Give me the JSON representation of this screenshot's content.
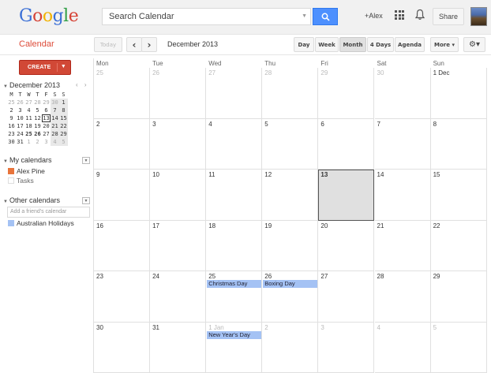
{
  "header": {
    "logo_letters": [
      "G",
      "o",
      "o",
      "g",
      "l",
      "e"
    ],
    "logo_colors": [
      "#3a6fd6",
      "#d64336",
      "#f2b200",
      "#3a6fd6",
      "#2f9e44",
      "#d64336"
    ],
    "search_placeholder": "Search Calendar",
    "user_label": "+Alex",
    "share_label": "Share"
  },
  "toolbar": {
    "app_name": "Calendar",
    "today_label": "Today",
    "prev_glyph": "‹",
    "next_glyph": "›",
    "period": "December 2013",
    "views": [
      "Day",
      "Week",
      "Month",
      "4 Days",
      "Agenda"
    ],
    "active_view": "Month",
    "more_label": "More ▾",
    "settings_glyph": "⚙▾"
  },
  "sidebar": {
    "create_label": "CREATE",
    "mini_title": "December 2013",
    "mini_nav": "‹ ›",
    "mini_dow": [
      "M",
      "T",
      "W",
      "T",
      "F",
      "S",
      "S"
    ],
    "mini_weeks": [
      [
        "25",
        "26",
        "27",
        "28",
        "29",
        "30",
        "1"
      ],
      [
        "2",
        "3",
        "4",
        "5",
        "6",
        "7",
        "8"
      ],
      [
        "9",
        "10",
        "11",
        "12",
        "13",
        "14",
        "15"
      ],
      [
        "16",
        "17",
        "18",
        "19",
        "20",
        "21",
        "22"
      ],
      [
        "23",
        "24",
        "25",
        "26",
        "27",
        "28",
        "29"
      ],
      [
        "30",
        "31",
        "1",
        "2",
        "3",
        "4",
        "5"
      ]
    ],
    "my_calendars_label": "My calendars",
    "my_calendars": [
      {
        "name": "Alex Pine",
        "color": "#e8743b"
      },
      {
        "name": "Tasks",
        "color": "#ffffff"
      }
    ],
    "other_calendars_label": "Other calendars",
    "add_friend_placeholder": "Add a friend's calendar",
    "other_calendars": [
      {
        "name": "Australian Holidays",
        "color": "#a4c2f4"
      }
    ]
  },
  "calendar": {
    "dow": [
      "Mon",
      "Tue",
      "Wed",
      "Thu",
      "Fri",
      "Sat",
      "Sun"
    ],
    "weeks": [
      [
        "25",
        "26",
        "27",
        "28",
        "29",
        "30",
        "1 Dec"
      ],
      [
        "2",
        "3",
        "4",
        "5",
        "6",
        "7",
        "8"
      ],
      [
        "9",
        "10",
        "11",
        "12",
        "13",
        "14",
        "15"
      ],
      [
        "16",
        "17",
        "18",
        "19",
        "20",
        "21",
        "22"
      ],
      [
        "23",
        "24",
        "25",
        "26",
        "27",
        "28",
        "29"
      ],
      [
        "30",
        "31",
        "1 Jan",
        "2",
        "3",
        "4",
        "5"
      ]
    ],
    "today": "13",
    "events": [
      {
        "title": "Christmas Day",
        "week": 4,
        "day": 2
      },
      {
        "title": "Boxing Day",
        "week": 4,
        "day": 3
      },
      {
        "title": "New Year's Day",
        "week": 5,
        "day": 2
      }
    ],
    "event_color": "#a4c2f4"
  }
}
